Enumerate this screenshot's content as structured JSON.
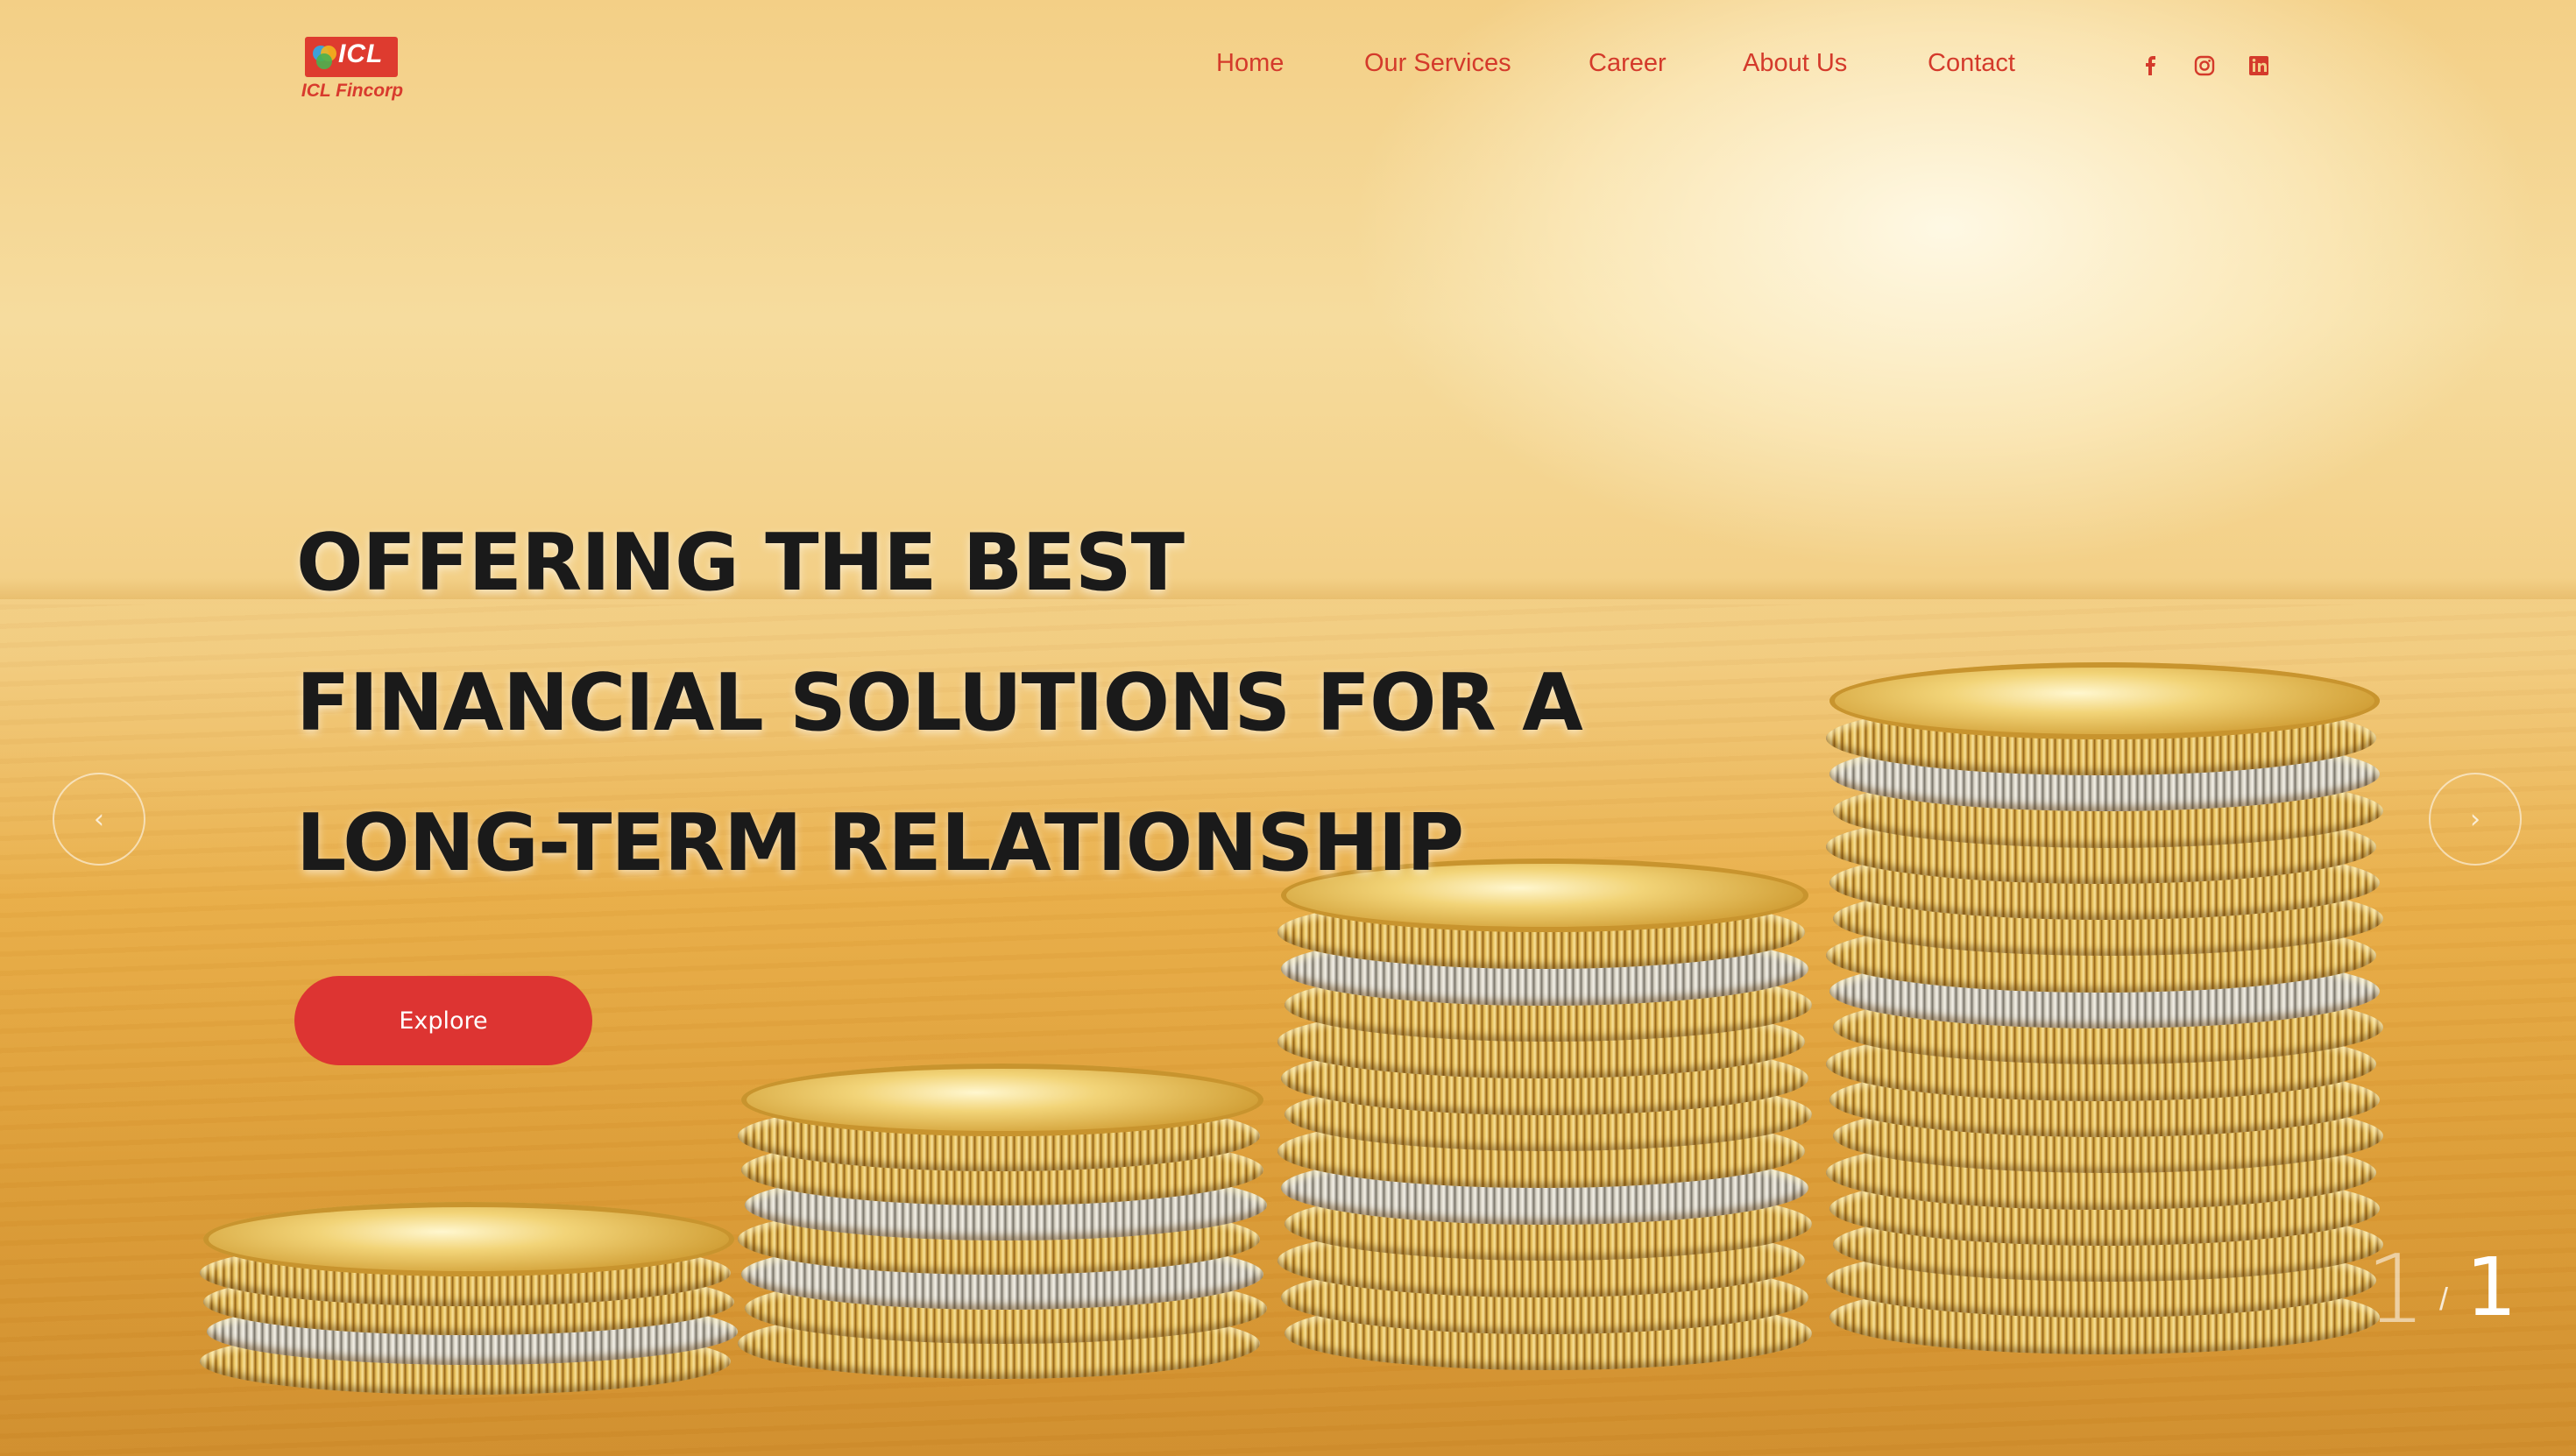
{
  "brand": {
    "mark": "ICL",
    "name": "ICL Fincorp",
    "badge_color": "#de3b2f"
  },
  "nav": {
    "items": [
      {
        "label": "Home"
      },
      {
        "label": "Our Services"
      },
      {
        "label": "Career"
      },
      {
        "label": "About Us"
      },
      {
        "label": "Contact"
      }
    ],
    "color": "#d43a2b"
  },
  "social": [
    {
      "icon": "facebook-icon"
    },
    {
      "icon": "instagram-icon"
    },
    {
      "icon": "linkedin-icon"
    }
  ],
  "hero": {
    "headline": [
      "OFFERING THE BEST",
      "FINANCIAL SOLUTIONS FOR A",
      " LONG-TERM RELATIONSHIP"
    ],
    "cta_label": "Explore",
    "cta_color": "#dd3432",
    "background": "gold coin stacks on wooden table"
  },
  "slider": {
    "prev_icon": "chevron-left-icon",
    "next_icon": "chevron-right-icon",
    "current": "1",
    "separator": "/",
    "total": "1"
  }
}
